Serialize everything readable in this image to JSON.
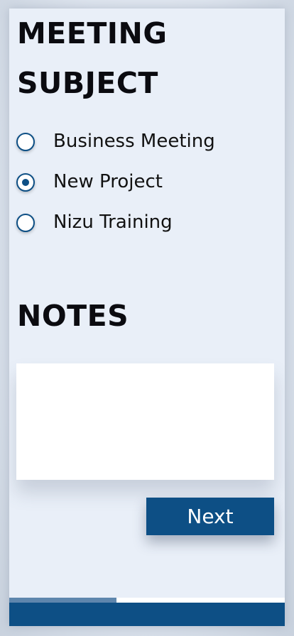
{
  "meeting": {
    "title": "MEETING SUBJECT",
    "options": [
      {
        "label": "Business Meeting",
        "selected": false
      },
      {
        "label": "New Project",
        "selected": true
      },
      {
        "label": "Nizu Training",
        "selected": false
      }
    ]
  },
  "notes": {
    "title": "NOTES",
    "value": "",
    "placeholder": ""
  },
  "actions": {
    "next_label": "Next"
  },
  "progress": {
    "fraction": 0.39
  },
  "colors": {
    "accent": "#0d4f85",
    "progress_fill": "#5e86ad",
    "panel_background": "#e9eff8"
  }
}
